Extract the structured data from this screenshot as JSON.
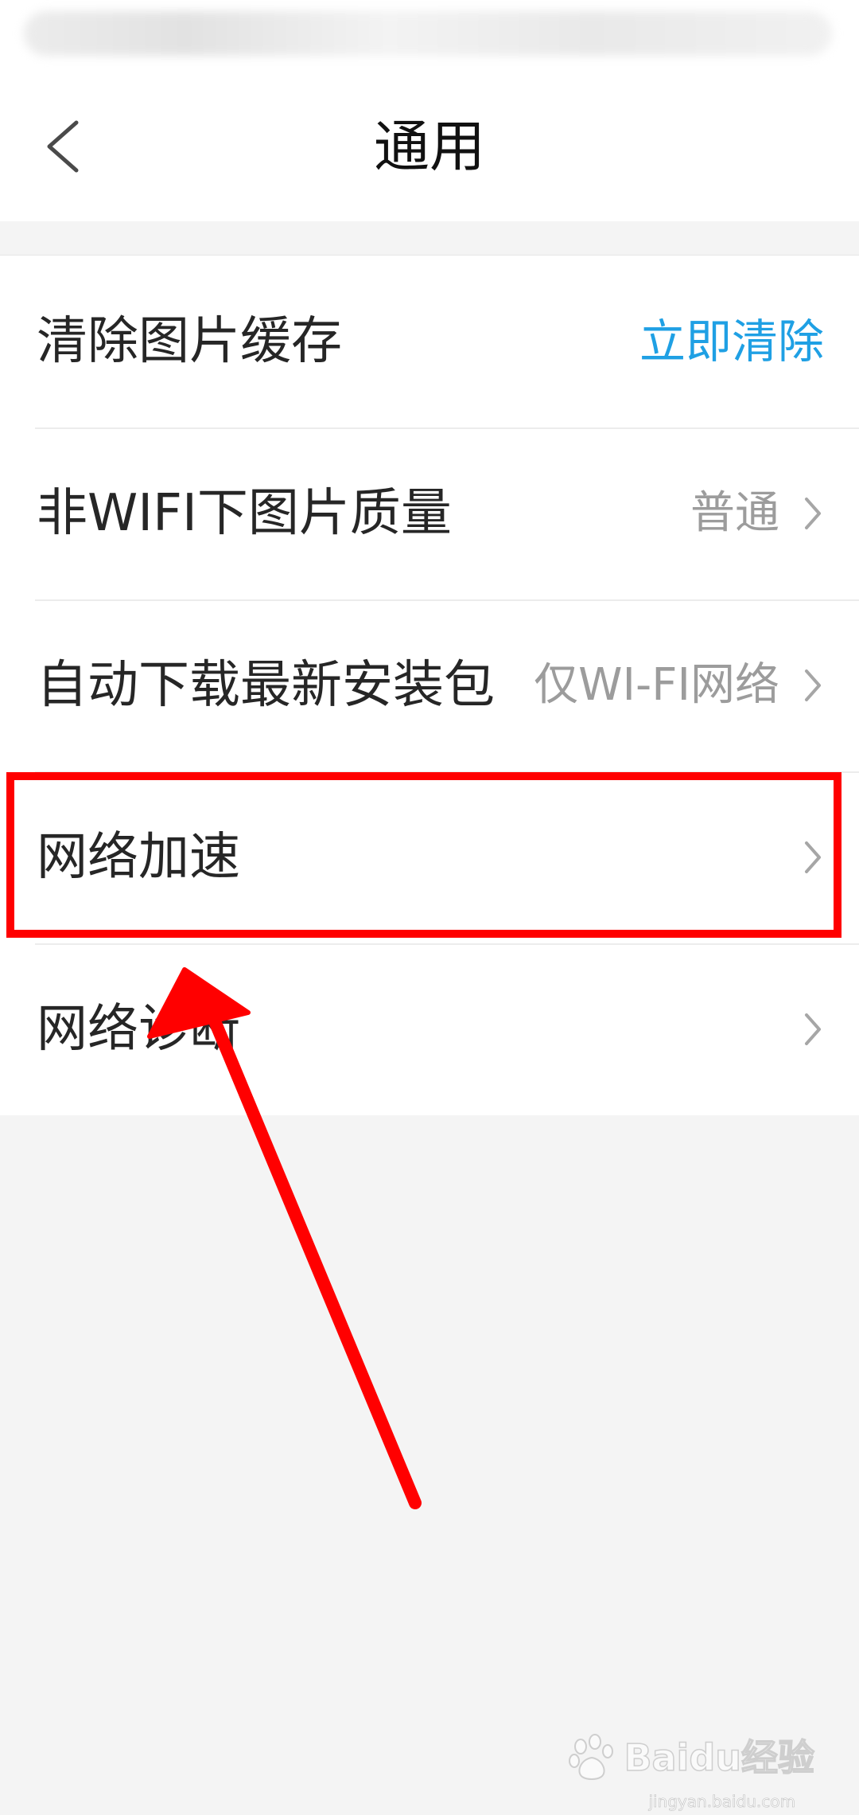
{
  "header": {
    "title": "通用",
    "back_icon": "chevron-left-icon"
  },
  "settings": [
    {
      "label": "清除图片缓存",
      "action": "立即清除"
    },
    {
      "label": "非WIFI下图片质量",
      "value": "普通"
    },
    {
      "label": "自动下载最新安装包",
      "value": "仅WI-FI网络"
    },
    {
      "label": "网络加速",
      "value": ""
    },
    {
      "label": "网络诊断",
      "value": ""
    }
  ],
  "colors": {
    "accent": "#1fa0e4",
    "annotation": "#ff0000",
    "background": "#f4f4f4"
  },
  "watermark": {
    "text": "Baidu经验",
    "sub": "jingyan.baidu.com"
  }
}
